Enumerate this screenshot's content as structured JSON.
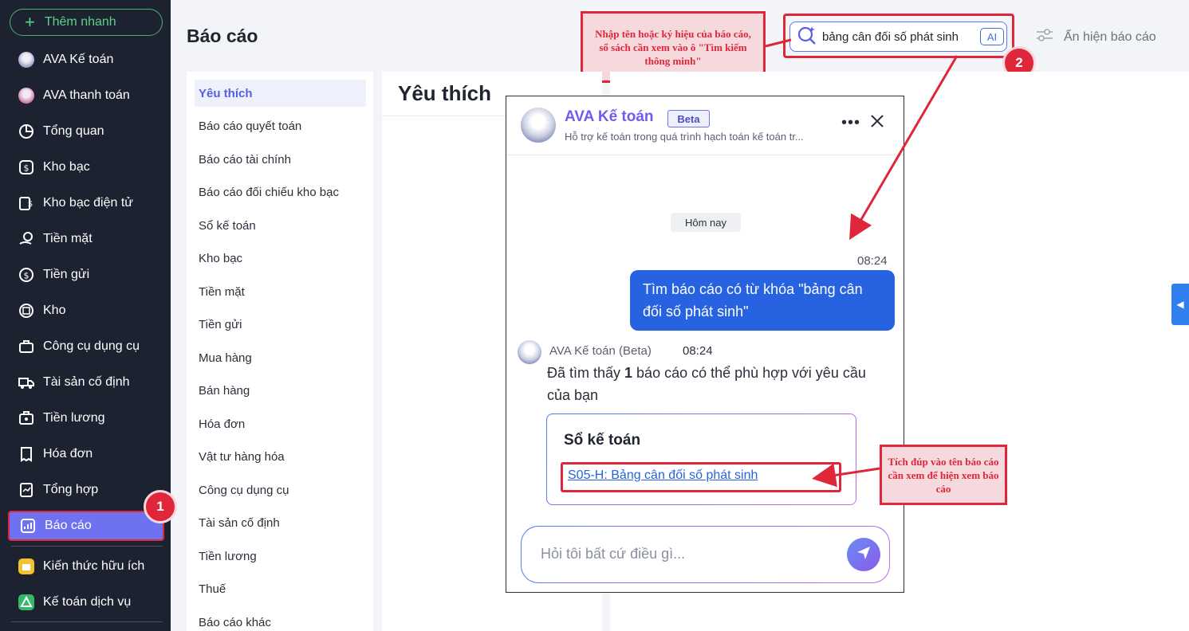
{
  "sidebar": {
    "quick_add": "Thêm nhanh",
    "items": [
      {
        "label": "AVA Kế toán",
        "icon": "ava-avatar-icon"
      },
      {
        "label": "AVA thanh toán",
        "icon": "ava-pay-avatar-icon"
      },
      {
        "label": "Tổng quan",
        "icon": "pie-chart-icon"
      },
      {
        "label": "Kho bạc",
        "icon": "treasury-icon"
      },
      {
        "label": "Kho bạc điện tử",
        "icon": "e-treasury-icon"
      },
      {
        "label": "Tiền mặt",
        "icon": "cash-icon"
      },
      {
        "label": "Tiền gửi",
        "icon": "deposit-icon"
      },
      {
        "label": "Kho",
        "icon": "warehouse-icon"
      },
      {
        "label": "Công cụ dụng cụ",
        "icon": "tools-icon"
      },
      {
        "label": "Tài sản cố định",
        "icon": "truck-icon"
      },
      {
        "label": "Tiền lương",
        "icon": "salary-icon"
      },
      {
        "label": "Hóa đơn",
        "icon": "invoice-icon"
      },
      {
        "label": "Tổng hợp",
        "icon": "summary-icon"
      },
      {
        "label": "Báo cáo",
        "icon": "report-chart-icon"
      },
      {
        "label": "Kiến thức hữu ích",
        "icon": "knowledge-icon"
      },
      {
        "label": "Kế toán dịch vụ",
        "icon": "service-icon"
      }
    ],
    "step1": "1"
  },
  "header": {
    "title": "Báo cáo",
    "search_value": "bảng cân đối số phát sinh",
    "ai_tag": "AI",
    "toggle_label": "Ẩn hiện báo cáo",
    "step2": "2",
    "callout_search": "Nhập tên hoặc ký hiệu của báo cáo, sổ sách cần xem vào ô \"Tìm kiếm thông minh\""
  },
  "categories": [
    "Yêu thích",
    "Báo cáo quyết toán",
    "Báo cáo tài chính",
    "Báo cáo đối chiếu kho bạc",
    "Sổ kế toán",
    "Kho bạc",
    "Tiền mặt",
    "Tiền gửi",
    "Mua hàng",
    "Bán hàng",
    "Hóa đơn",
    "Vật tư hàng hóa",
    "Công cụ dụng cụ",
    "Tài sản cố định",
    "Tiền lương",
    "Thuế",
    "Báo cáo khác"
  ],
  "favorites": {
    "title": "Yêu thích"
  },
  "chat": {
    "name": "AVA Kế toán",
    "beta": "Beta",
    "subtitle": "Hỗ trợ kế toán trong quá trình hạch toán kế toán tr...",
    "day": "Hôm nay",
    "user_time": "08:24",
    "user_message": "Tìm báo cáo có từ khóa \"bảng cân đối số phát sinh\"",
    "bot_name": "AVA Kế toán (Beta)",
    "bot_time": "08:24",
    "bot_msg_pre": "Đã tìm thấy ",
    "bot_msg_count": "1",
    "bot_msg_post": " báo cáo có thể phù hợp với yêu cầu của bạn",
    "result_title": "Sổ kế toán",
    "result_link": "S05-H: Bảng cân đối số phát sinh",
    "input_placeholder": "Hỏi tôi bất cứ điều gì...",
    "callout_link": "Tích đúp vào tên báo cáo cần xem để hiện xem báo cáo"
  },
  "colors": {
    "accent": "#6e72f0",
    "annotation": "#e0263a",
    "link": "#2762e0",
    "sidebar": "#1d2230"
  }
}
